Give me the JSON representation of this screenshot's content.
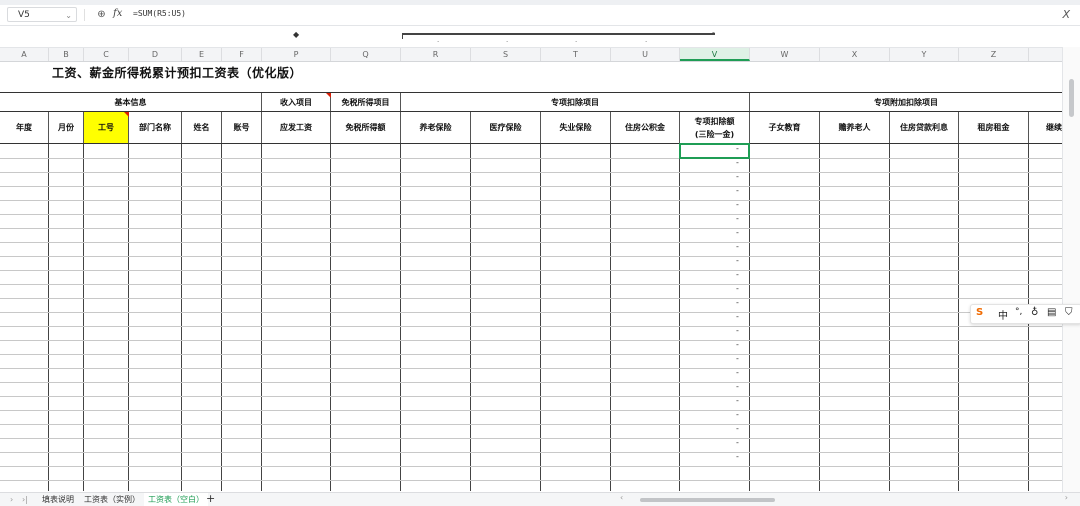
{
  "formula_bar": {
    "name_box": "V5",
    "formula": "=SUM(R5:U5)",
    "zoom_icon": "zoom-icon",
    "fx_label": "fx"
  },
  "columns": [
    "A",
    "B",
    "C",
    "D",
    "E",
    "F",
    "P",
    "Q",
    "R",
    "S",
    "T",
    "U",
    "V",
    "W",
    "X",
    "Y",
    "Z"
  ],
  "active_column": "V",
  "sheet": {
    "title": "工资、薪金所得税累计预扣工资表（优化版）",
    "groups": {
      "basic": "基本信息",
      "income": "收入项目",
      "exempt": "免税所得项目",
      "special": "专项扣除项目",
      "additional": "专项附加扣除项目"
    },
    "headers": {
      "year": "年度",
      "month": "月份",
      "empno": "工号",
      "dept": "部门名称",
      "name": "姓名",
      "account": "账号",
      "gross": "应发工资",
      "exempt_income": "免税所得额",
      "pension": "养老保险",
      "medical": "医疗保险",
      "unemployment": "失业保险",
      "housing_fund": "住房公积金",
      "special_total_1": "专项扣除额",
      "special_total_2": "(三险一金)",
      "children_edu": "子女教育",
      "elderly": "赡养老人",
      "mortgage": "住房贷款利息",
      "rent": "租房租金",
      "continuing_edu": "继续"
    },
    "dash": "-"
  },
  "ime": {
    "logo": "S",
    "lang": "中"
  },
  "tabs": [
    {
      "label": "填表说明",
      "active": false
    },
    {
      "label": "工资表（实例）",
      "active": false
    },
    {
      "label": "工资表（空白）",
      "active": true
    }
  ],
  "tab_add": "+",
  "colors": {
    "accent": "#1f9d55",
    "highlight": "#ffff00",
    "comment_marker": "#d81e06"
  }
}
